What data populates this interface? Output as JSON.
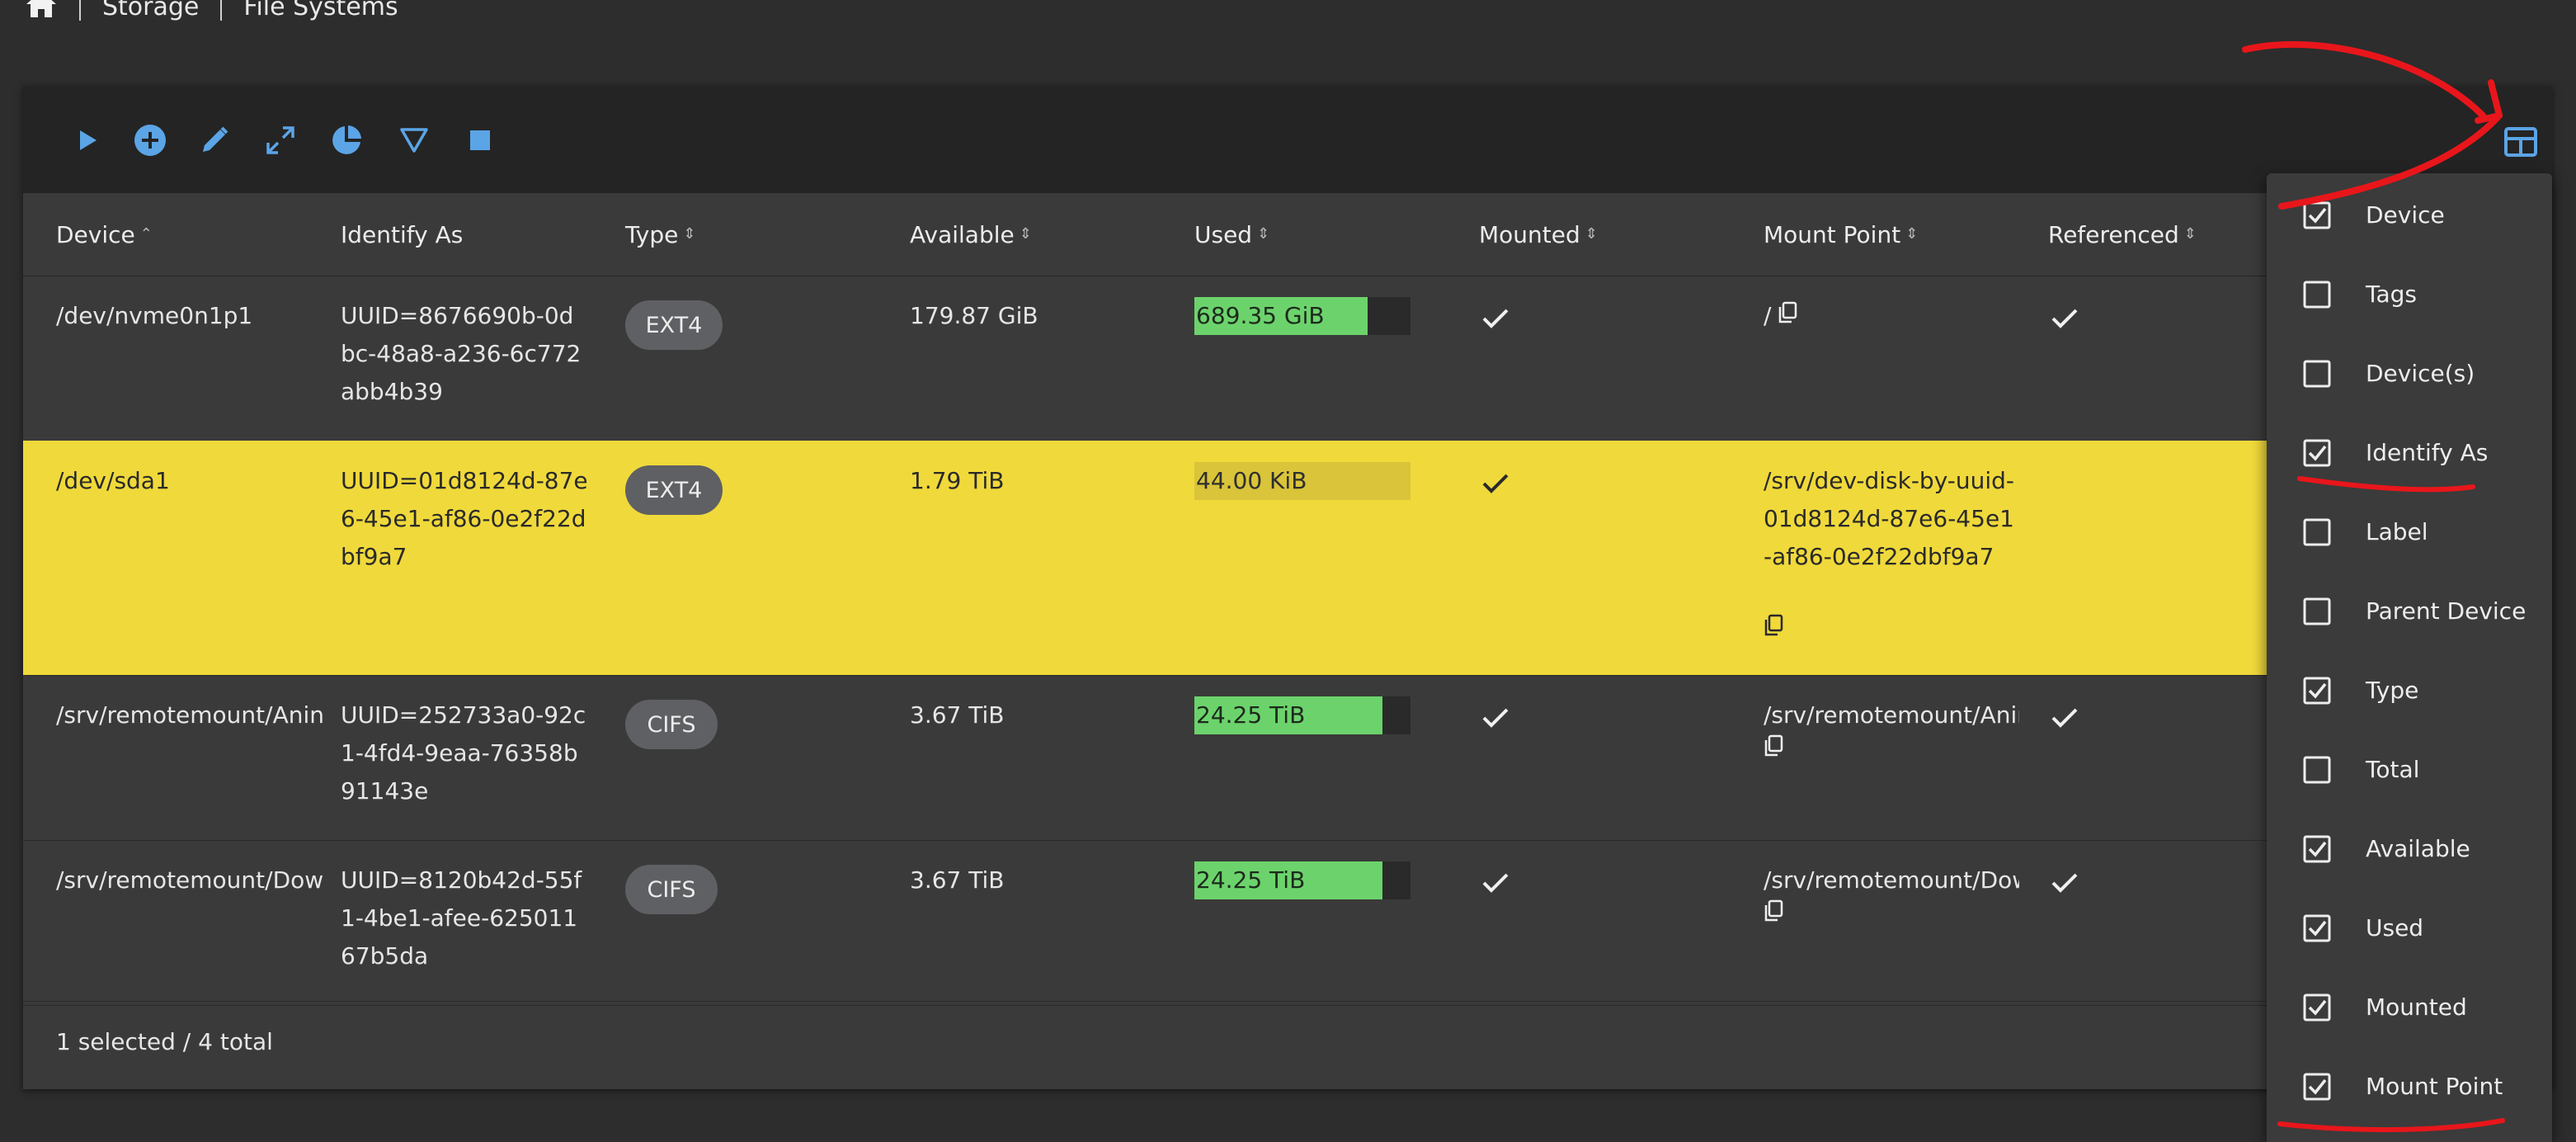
{
  "breadcrumb": {
    "items": [
      "Storage",
      "File Systems"
    ]
  },
  "colors": {
    "accent": "#5ba4e6",
    "selected_row": "#f0d93b",
    "used_bar": "#6cd36c",
    "annotation": "#e8161b"
  },
  "toolbar": {
    "icons": [
      "play-icon",
      "add-circle-icon",
      "pencil-icon",
      "expand-icon",
      "chart-pie-icon",
      "filter-icon",
      "stop-icon"
    ]
  },
  "table": {
    "headers": {
      "device": "Device",
      "identify_as": "Identify As",
      "type": "Type",
      "available": "Available",
      "used": "Used",
      "mounted": "Mounted",
      "mount_point": "Mount Point",
      "referenced": "Referenced"
    },
    "rows": [
      {
        "device": "/dev/nvme0n1p1",
        "identify_as": "UUID=8676690b-0dbc-48a8-a236-6c772abb4b39",
        "type": "EXT4",
        "available": "179.87 GiB",
        "used": "689.35 GiB",
        "used_fraction": 0.8,
        "mounted": true,
        "mount_point": "/",
        "referenced": true,
        "selected": false
      },
      {
        "device": "/dev/sda1",
        "identify_as": "UUID=01d8124d-87e6-45e1-af86-0e2f22dbf9a7",
        "type": "EXT4",
        "available": "1.79 TiB",
        "used": "44.00 KiB",
        "used_fraction": 0.0,
        "mounted": true,
        "mount_point": "/srv/dev-disk-by-uuid-01d8124d-87e6-45e1-af86-0e2f22dbf9a7",
        "referenced": false,
        "selected": true
      },
      {
        "device": "/srv/remotemount/Anin",
        "identify_as": "UUID=252733a0-92c1-4fd4-9eaa-76358b91143e",
        "type": "CIFS",
        "available": "3.67 TiB",
        "used": "24.25 TiB",
        "used_fraction": 0.87,
        "mounted": true,
        "mount_point": "/srv/remotemount/Anin",
        "referenced": true,
        "selected": false
      },
      {
        "device": "/srv/remotemount/Dow",
        "identify_as": "UUID=8120b42d-55f1-4be1-afee-62501167b5da",
        "type": "CIFS",
        "available": "3.67 TiB",
        "used": "24.25 TiB",
        "used_fraction": 0.87,
        "mounted": true,
        "mount_point": "/srv/remotemount/Dow",
        "referenced": true,
        "selected": false
      }
    ]
  },
  "footer": {
    "status": "1 selected / 4 total"
  },
  "column_menu": {
    "items": [
      {
        "label": "Device",
        "checked": true
      },
      {
        "label": "Tags",
        "checked": false
      },
      {
        "label": "Device(s)",
        "checked": false
      },
      {
        "label": "Identify As",
        "checked": true
      },
      {
        "label": "Label",
        "checked": false
      },
      {
        "label": "Parent Device",
        "checked": false
      },
      {
        "label": "Type",
        "checked": true
      },
      {
        "label": "Total",
        "checked": false
      },
      {
        "label": "Available",
        "checked": true
      },
      {
        "label": "Used",
        "checked": true
      },
      {
        "label": "Mounted",
        "checked": true
      },
      {
        "label": "Mount Point",
        "checked": true
      }
    ]
  }
}
